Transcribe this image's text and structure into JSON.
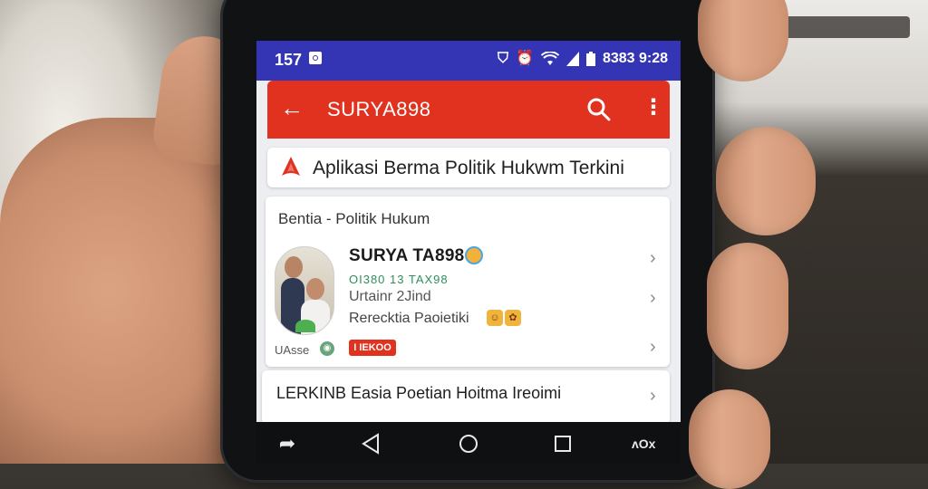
{
  "status_bar": {
    "time": "157",
    "right_text": "8383 9:28",
    "icons": [
      "shield-icon",
      "alarm-icon",
      "wifi-icon",
      "signal-icon",
      "battery-icon"
    ]
  },
  "app_bar": {
    "title": "SURYA898",
    "back_icon": "back-arrow-icon",
    "search_icon": "search-icon",
    "more_icon": "more-vert-icon",
    "color": "#e0321f"
  },
  "banner": {
    "text": "Aplikasi Berma Politik Hukwm Terkini"
  },
  "card": {
    "header": "Bentia - Politik Hukum",
    "item": {
      "title": "SURYA TA898",
      "subtitle": "OI380 13 TAX98",
      "line1": "Urtainr 2Jind",
      "line2": "Rerecktia Paoietiki",
      "meta": "UAsse",
      "tag": "I IEKOO"
    }
  },
  "card2": {
    "title": "LERKINB Easia Poetian Hoitma Ireoimi"
  },
  "nav_bar": {
    "label": "ʌΟx"
  },
  "colors": {
    "status_bar": "#3335b5",
    "accent": "#e0321f",
    "subtitle_green": "#2e8f5a"
  }
}
